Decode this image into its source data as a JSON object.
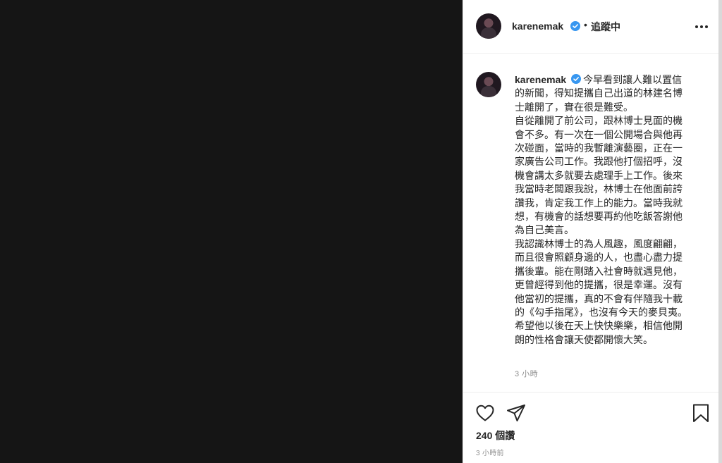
{
  "post": {
    "username": "karenemak",
    "follow_separator": "•",
    "follow_status": "追蹤中",
    "verified_color": "#3897f0",
    "caption": "今早看到讓人難以置信的新聞，得知提攜自己出道的林建名博士離開了，實在很是難受。\n自從離開了前公司，跟林博士見面的機會不多。有一次在一個公開場合與他再次碰面，當時的我暫離演藝圈，正在一家廣告公司工作。我跟他打個招呼，沒機會講太多就要去處理手上工作。後來我當時老闆跟我說，林博士在他面前誇讚我，肯定我工作上的能力。當時我就想，有機會的話想要再約他吃飯答謝他為自己美言。\n我認識林博士的為人風趣，風度翩翩，而且很會照顧身邊的人，也盡心盡力提攜後輩。能在剛踏入社會時就遇見他，更曾經得到他的提攜，很是幸運。沒有他當初的提攜，真的不會有伴隨我十載的《勾手指尾》，也沒有今天的麥貝夷。希望他以後在天上快快樂樂，相信他開朗的性格會讓天使都開懷大笑。",
    "caption_time": "3 小時",
    "likes": "240 個讚",
    "post_time": "3 小時前"
  },
  "icons": {
    "more": "more-options-icon",
    "like": "heart-icon",
    "share": "paper-plane-icon",
    "save": "bookmark-icon",
    "verified": "verified-badge-icon"
  }
}
